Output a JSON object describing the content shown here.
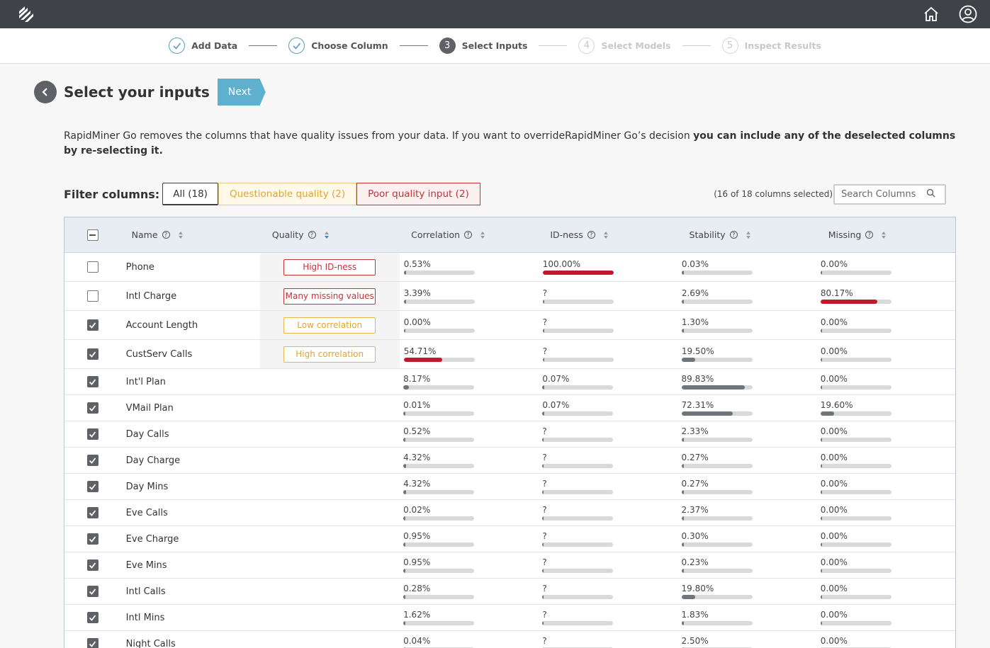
{
  "stepper": [
    {
      "num": "1",
      "label": "Add Data",
      "state": "done"
    },
    {
      "num": "2",
      "label": "Choose Column",
      "state": "done"
    },
    {
      "num": "3",
      "label": "Select Inputs",
      "state": "active"
    },
    {
      "num": "4",
      "label": "Select Models",
      "state": "future"
    },
    {
      "num": "5",
      "label": "Inspect Results",
      "state": "future"
    }
  ],
  "page": {
    "title": "Select your inputs",
    "next_label": "Next",
    "desc_normal": "RapidMiner Go removes the columns that have quality issues from your data. If you want to overrideRapidMiner Go’s decision ",
    "desc_bold": "you can include any of the deselected columns by re-selecting it."
  },
  "filter": {
    "label": "Filter columns:",
    "all": "All (18)",
    "questionable": "Questionable quality (2)",
    "poor": "Poor quality input (2)",
    "selected_count": "(16 of 18 columns selected)",
    "search_placeholder": "Search Columns"
  },
  "table": {
    "headers": {
      "name": "Name",
      "quality": "Quality",
      "correlation": "Correlation",
      "idness": "ID-ness",
      "stability": "Stability",
      "missing": "Missing"
    },
    "rows": [
      {
        "checked": false,
        "name": "Phone",
        "quality": "High ID-ness",
        "qcolor": "red",
        "corr": "0.53%",
        "corr_p": 0.53,
        "corr_red": false,
        "id": "100.00%",
        "id_p": 100,
        "id_red": true,
        "stab": "0.03%",
        "stab_p": 0.03,
        "miss": "0.00%",
        "miss_p": 0,
        "miss_red": false
      },
      {
        "checked": false,
        "name": "Intl Charge",
        "quality": "Many missing values",
        "qcolor": "red",
        "corr": "3.39%",
        "corr_p": 3.39,
        "corr_red": false,
        "id": "?",
        "id_p": 0,
        "id_red": false,
        "stab": "2.69%",
        "stab_p": 2.69,
        "miss": "80.17%",
        "miss_p": 80.17,
        "miss_red": true
      },
      {
        "checked": true,
        "name": "Account Length",
        "quality": "Low correlation",
        "qcolor": "yellow",
        "corr": "0.00%",
        "corr_p": 0,
        "corr_red": false,
        "id": "?",
        "id_p": 0,
        "id_red": false,
        "stab": "1.30%",
        "stab_p": 1.3,
        "miss": "0.00%",
        "miss_p": 0,
        "miss_red": false
      },
      {
        "checked": true,
        "name": "CustServ Calls",
        "quality": "High correlation",
        "qcolor": "yellow",
        "corr": "54.71%",
        "corr_p": 54.71,
        "corr_red": true,
        "id": "?",
        "id_p": 0,
        "id_red": false,
        "stab": "19.50%",
        "stab_p": 19.5,
        "miss": "0.00%",
        "miss_p": 0,
        "miss_red": false
      },
      {
        "checked": true,
        "name": "Int'l Plan",
        "quality": "",
        "qcolor": "",
        "corr": "8.17%",
        "corr_p": 8.17,
        "corr_red": false,
        "id": "0.07%",
        "id_p": 0.07,
        "id_red": false,
        "stab": "89.83%",
        "stab_p": 89.83,
        "miss": "0.00%",
        "miss_p": 0,
        "miss_red": false
      },
      {
        "checked": true,
        "name": "VMail Plan",
        "quality": "",
        "qcolor": "",
        "corr": "0.01%",
        "corr_p": 0.01,
        "corr_red": false,
        "id": "0.07%",
        "id_p": 0.07,
        "id_red": false,
        "stab": "72.31%",
        "stab_p": 72.31,
        "miss": "19.60%",
        "miss_p": 19.6,
        "miss_red": false
      },
      {
        "checked": true,
        "name": "Day Calls",
        "quality": "",
        "qcolor": "",
        "corr": "0.52%",
        "corr_p": 0.52,
        "corr_red": false,
        "id": "?",
        "id_p": 0,
        "id_red": false,
        "stab": "2.33%",
        "stab_p": 2.33,
        "miss": "0.00%",
        "miss_p": 0,
        "miss_red": false
      },
      {
        "checked": true,
        "name": "Day Charge",
        "quality": "",
        "qcolor": "",
        "corr": "4.32%",
        "corr_p": 4.32,
        "corr_red": false,
        "id": "?",
        "id_p": 0,
        "id_red": false,
        "stab": "0.27%",
        "stab_p": 0.27,
        "miss": "0.00%",
        "miss_p": 0,
        "miss_red": false
      },
      {
        "checked": true,
        "name": "Day Mins",
        "quality": "",
        "qcolor": "",
        "corr": "4.32%",
        "corr_p": 4.32,
        "corr_red": false,
        "id": "?",
        "id_p": 0,
        "id_red": false,
        "stab": "0.27%",
        "stab_p": 0.27,
        "miss": "0.00%",
        "miss_p": 0,
        "miss_red": false
      },
      {
        "checked": true,
        "name": "Eve Calls",
        "quality": "",
        "qcolor": "",
        "corr": "0.02%",
        "corr_p": 0.02,
        "corr_red": false,
        "id": "?",
        "id_p": 0,
        "id_red": false,
        "stab": "2.37%",
        "stab_p": 2.37,
        "miss": "0.00%",
        "miss_p": 0,
        "miss_red": false
      },
      {
        "checked": true,
        "name": "Eve Charge",
        "quality": "",
        "qcolor": "",
        "corr": "0.95%",
        "corr_p": 0.95,
        "corr_red": false,
        "id": "?",
        "id_p": 0,
        "id_red": false,
        "stab": "0.30%",
        "stab_p": 0.3,
        "miss": "0.00%",
        "miss_p": 0,
        "miss_red": false
      },
      {
        "checked": true,
        "name": "Eve Mins",
        "quality": "",
        "qcolor": "",
        "corr": "0.95%",
        "corr_p": 0.95,
        "corr_red": false,
        "id": "?",
        "id_p": 0,
        "id_red": false,
        "stab": "0.23%",
        "stab_p": 0.23,
        "miss": "0.00%",
        "miss_p": 0,
        "miss_red": false
      },
      {
        "checked": true,
        "name": "Intl Calls",
        "quality": "",
        "qcolor": "",
        "corr": "0.28%",
        "corr_p": 0.28,
        "corr_red": false,
        "id": "?",
        "id_p": 0,
        "id_red": false,
        "stab": "19.80%",
        "stab_p": 19.8,
        "miss": "0.00%",
        "miss_p": 0,
        "miss_red": false
      },
      {
        "checked": true,
        "name": "Intl Mins",
        "quality": "",
        "qcolor": "",
        "corr": "1.62%",
        "corr_p": 1.62,
        "corr_red": false,
        "id": "?",
        "id_p": 0,
        "id_red": false,
        "stab": "1.83%",
        "stab_p": 1.83,
        "miss": "0.00%",
        "miss_p": 0,
        "miss_red": false
      },
      {
        "checked": true,
        "name": "Night Calls",
        "quality": "",
        "qcolor": "",
        "corr": "0.04%",
        "corr_p": 0.04,
        "corr_red": false,
        "id": "?",
        "id_p": 0,
        "id_red": false,
        "stab": "2.50%",
        "stab_p": 2.5,
        "miss": "0.00%",
        "miss_p": 0,
        "miss_red": false
      }
    ]
  }
}
